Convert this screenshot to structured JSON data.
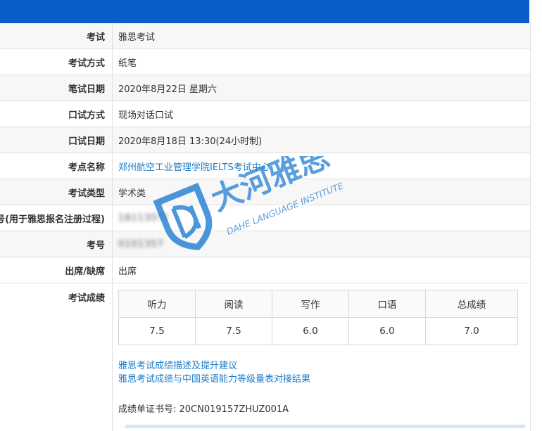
{
  "rows": [
    {
      "label": "考试",
      "value": "雅思考试"
    },
    {
      "label": "考试方式",
      "value": "纸笔"
    },
    {
      "label": "笔试日期",
      "value": "2020年8月22日 星期六"
    },
    {
      "label": "口试方式",
      "value": "现场对话口试"
    },
    {
      "label": "口试日期",
      "value": "2020年8月18日 13:30(24小时制)"
    },
    {
      "label": "考点名称",
      "value": "郑州航空工业管理学院IELTS考试中心"
    },
    {
      "label": "考试类型",
      "value": "学术类"
    },
    {
      "label": "号(用于雅思报名注册过程)",
      "value": "181135??"
    },
    {
      "label": "考号",
      "value": "0101357"
    },
    {
      "label": "出席/缺席",
      "value": "出席"
    }
  ],
  "scores": {
    "label": "考试成绩",
    "headers": [
      "听力",
      "阅读",
      "写作",
      "口语",
      "总成绩"
    ],
    "values": [
      "7.5",
      "7.5",
      "6.0",
      "6.0",
      "7.0"
    ]
  },
  "links": {
    "description": "雅思考试成绩描述及提升建议",
    "cefr": "雅思考试成绩与中国英语能力等级量表对接结果"
  },
  "certificate": "成绩单证书号: 20CN019157ZHUZ001A",
  "watermark": {
    "cn": "大河雅思",
    "en": "DAHE LANGUAGE INSTITUTE",
    "color": "#1a78d0"
  }
}
